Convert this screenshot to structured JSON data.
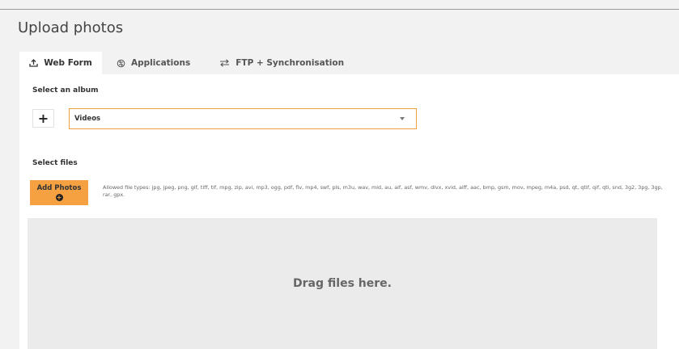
{
  "page": {
    "title": "Upload photos"
  },
  "tabs": [
    {
      "label": "Web Form",
      "icon": "upload-icon",
      "active": true
    },
    {
      "label": "Applications",
      "icon": "apps-icon",
      "active": false
    },
    {
      "label": "FTP + Synchronisation",
      "icon": "sync-arrows-icon",
      "active": false
    }
  ],
  "album": {
    "label": "Select an album",
    "add_button": "+",
    "selected": "Videos"
  },
  "files": {
    "label": "Select files",
    "add_button": "Add Photos",
    "allowed_text": "Allowed file types: jpg, jpeg, png, gif, tiff, tif, mpg, zip, avi, mp3, ogg, pdf, flv, mp4, swf, pls, m3u, wav, mid, au, aif, asf, wmv, divx, xvid, aiff, aac, bmp, gsm, mov, mpeg, m4a, psd, qt, qtif, qif, qti, snd, 3g2, 3pg, 3gp, rar, gpx.",
    "dropzone_text": "Drag files here."
  },
  "colors": {
    "accent": "#f5a142",
    "select_border": "#f0a040",
    "dropzone": "#ebebeb"
  }
}
